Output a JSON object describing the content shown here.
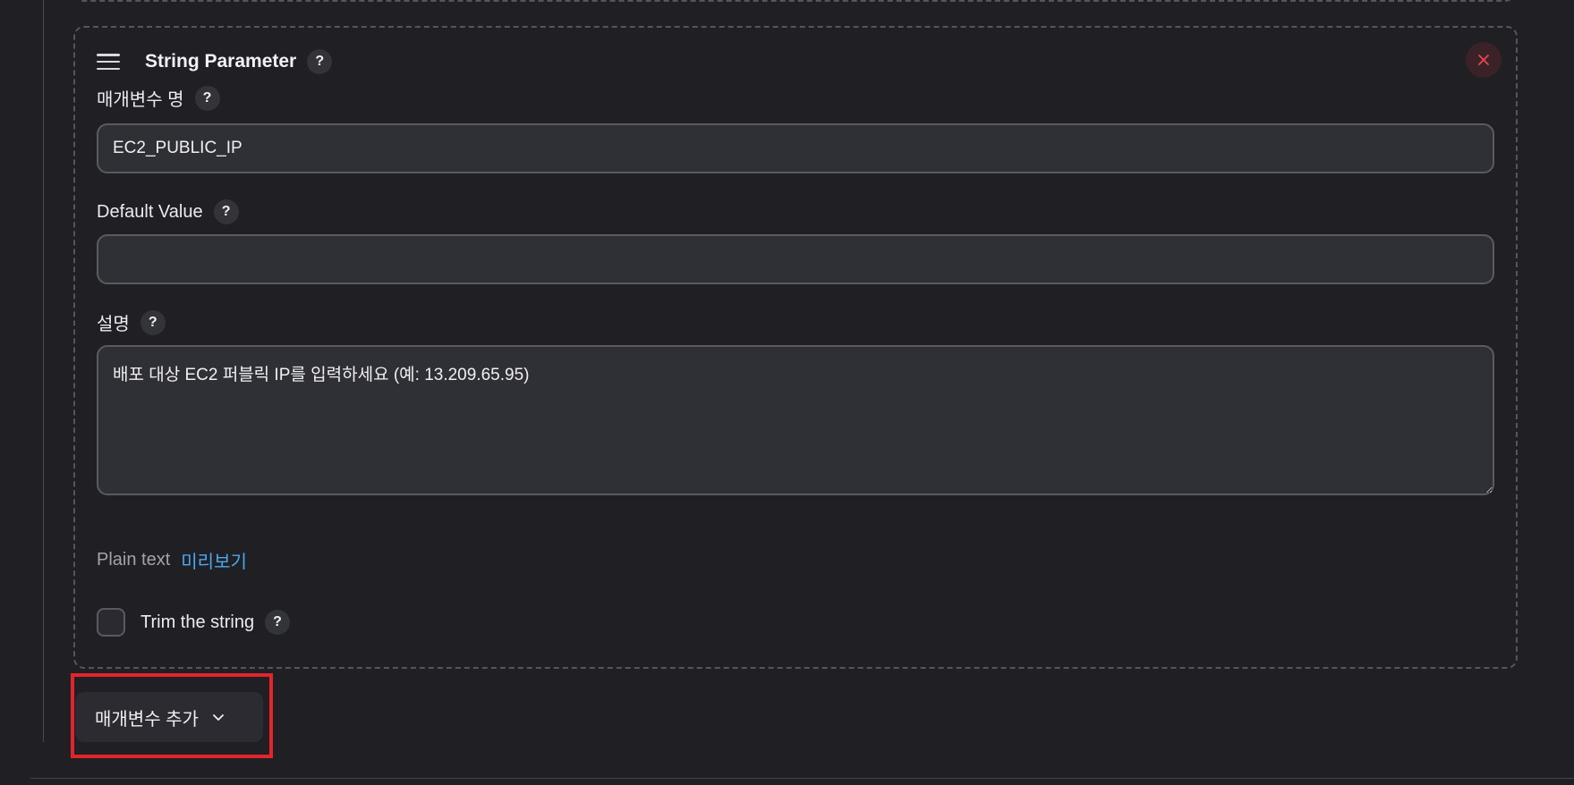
{
  "parameter_card": {
    "title": "String Parameter",
    "help_symbol": "?",
    "fields": {
      "name": {
        "label": "매개변수 명",
        "value": "EC2_PUBLIC_IP"
      },
      "default_value": {
        "label": "Default Value",
        "value": ""
      },
      "description": {
        "label": "설명",
        "value": "배포 대상 EC2 퍼블릭 IP를 입력하세요 (예: 13.209.65.95)"
      }
    },
    "format": {
      "type": "Plain text",
      "preview_link": "미리보기"
    },
    "trim_checkbox": {
      "label": "Trim the string",
      "checked": false
    },
    "icons": {
      "drag": "drag-handle-icon",
      "close": "close-icon",
      "help": "help-icon"
    }
  },
  "add_parameter_button": {
    "label": "매개변수 추가",
    "icon": "chevron-down-icon"
  },
  "colors": {
    "background": "#1f1f24",
    "input_background": "#2f2f36",
    "link": "#4aa8f0",
    "close_icon": "#e5484d",
    "highlight_box": "#e3242b"
  }
}
